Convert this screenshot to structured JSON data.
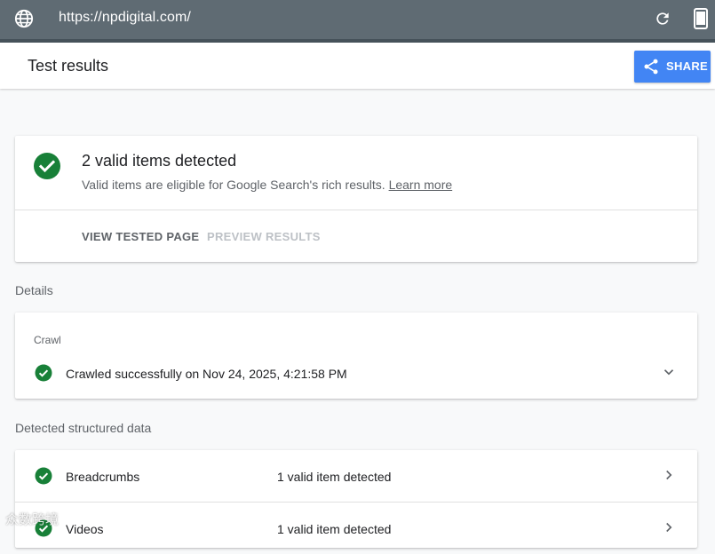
{
  "browser": {
    "url": "https://npdigital.com/"
  },
  "header": {
    "title": "Test results",
    "share_label": "SHARE"
  },
  "summary": {
    "headline": "2 valid items detected",
    "description": "Valid items are eligible for Google Search's rich results.",
    "learn_more": "Learn more",
    "tabs": [
      {
        "label": "VIEW TESTED PAGE",
        "enabled": true
      },
      {
        "label": "PREVIEW RESULTS",
        "enabled": false
      }
    ]
  },
  "details": {
    "section_label": "Details",
    "crawl_label": "Crawl",
    "crawl_message": "Crawled successfully on Nov 24, 2025, 4:21:58 PM"
  },
  "structured_data": {
    "section_label": "Detected structured data",
    "items": [
      {
        "name": "Breadcrumbs",
        "status": "1 valid item detected"
      },
      {
        "name": "Videos",
        "status": "1 valid item detected"
      }
    ]
  },
  "watermark": "众数跨境",
  "colors": {
    "success": "#188038",
    "accent": "#4285f4",
    "urlbar": "#5f6b73"
  },
  "icons": [
    "globe-icon",
    "refresh-icon",
    "phone-icon",
    "share-icon",
    "check-circle-icon",
    "chevron-down-icon",
    "chevron-right-icon"
  ]
}
